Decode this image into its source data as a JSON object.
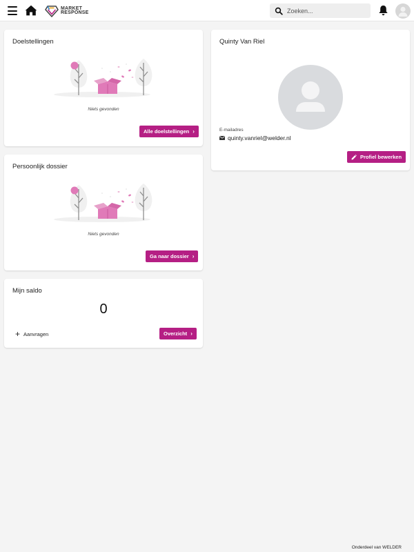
{
  "header": {
    "brand_line1": "MARKET",
    "brand_line2": "RESPONSE",
    "search_placeholder": "Zoeken..."
  },
  "goals": {
    "title": "Doelstellingen",
    "empty_text": "Niets gevonden",
    "button_label": "Alle doelstellingen"
  },
  "dossier": {
    "title": "Persoonlijk dossier",
    "empty_text": "Niets gevonden",
    "button_label": "Ga naar dossier"
  },
  "balance": {
    "title": "Mijn saldo",
    "value": "0",
    "request_label": "Aanvragen",
    "overview_label": "Overzicht"
  },
  "profile": {
    "name": "Quinty Van Riel",
    "email_label": "E-mailadres",
    "email": "quinty.vanriel@welder.nl",
    "edit_label": "Profiel bewerken"
  },
  "footer": {
    "text": "Onderdeel van WELDER"
  },
  "colors": {
    "accent": "#b51f84",
    "illustration_pink": "#e07ab8",
    "background": "#f4f4f4"
  },
  "icons": [
    "menu-icon",
    "home-icon",
    "logo-icon",
    "search-icon",
    "bell-icon",
    "user-icon",
    "envelope-icon",
    "pencil-icon",
    "chevron-right-icon",
    "plus-icon"
  ]
}
